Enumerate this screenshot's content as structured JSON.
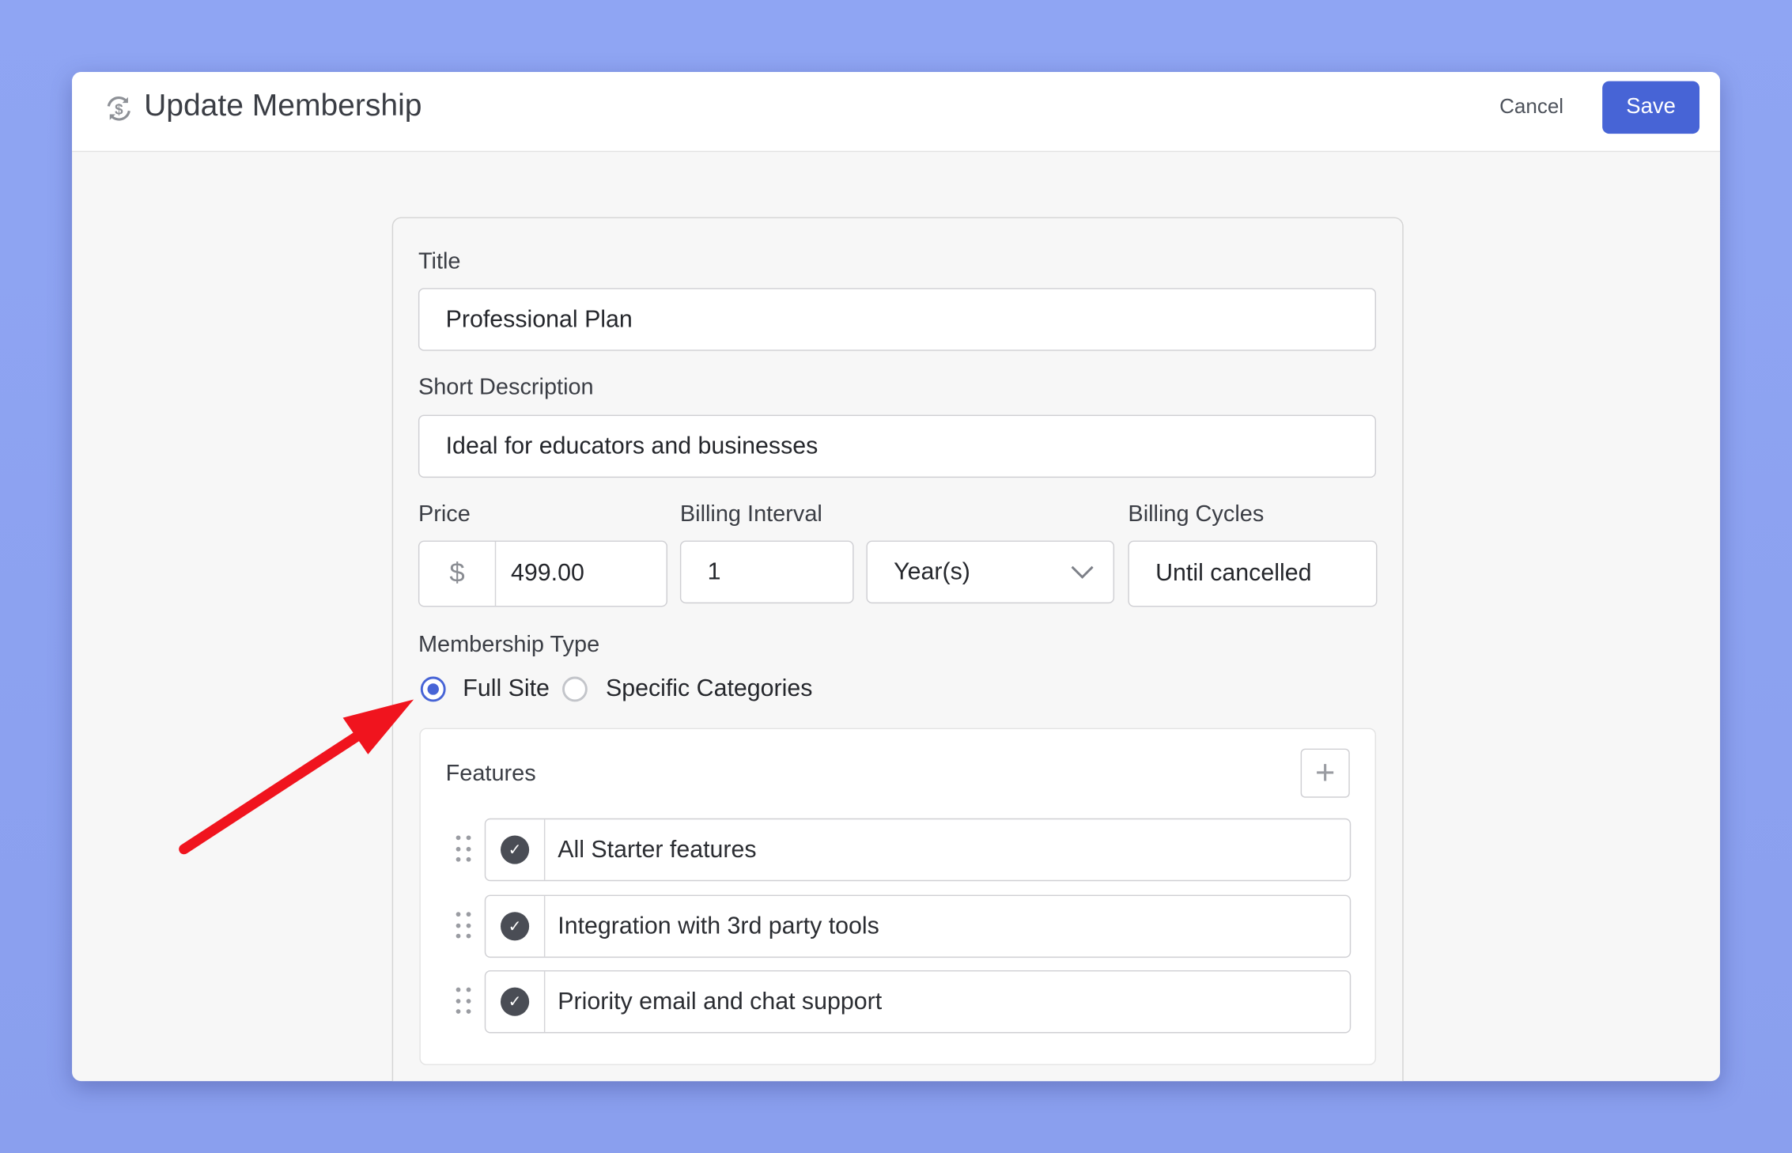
{
  "header": {
    "title": "Update Membership",
    "icon": "dollar-sync-icon",
    "cancel_label": "Cancel",
    "save_label": "Save"
  },
  "form": {
    "title_label": "Title",
    "title_value": "Professional Plan",
    "description_label": "Short Description",
    "description_value": "Ideal for educators and businesses",
    "price_label": "Price",
    "currency_symbol": "$",
    "price_value": "499.00",
    "interval_label": "Billing Interval",
    "interval_value": "1",
    "interval_unit": "Year(s)",
    "cycles_label": "Billing Cycles",
    "cycles_value": "Until cancelled",
    "membership_type_label": "Membership Type",
    "membership_types": [
      {
        "label": "Full Site",
        "selected": true
      },
      {
        "label": "Specific Categories",
        "selected": false
      }
    ],
    "features_label": "Features",
    "features": [
      "All Starter features",
      "Integration with 3rd party tools",
      "Priority email and chat support"
    ]
  },
  "colors": {
    "accent": "#4764d6",
    "annotation_arrow": "#f0141e",
    "background": "#8ea3f1"
  }
}
